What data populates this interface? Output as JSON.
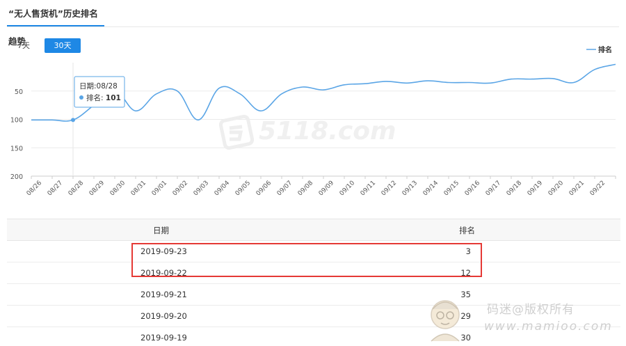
{
  "header": {
    "title": "“无人售货机”历史排名趋势"
  },
  "range_buttons": {
    "seven_days": "7天",
    "thirty_days": "30天"
  },
  "legend": {
    "label": "排名"
  },
  "tooltip": {
    "date_label": "日期:",
    "date_value": "08/28",
    "rank_label": "排名:",
    "rank_value": "101"
  },
  "chart_data": {
    "type": "line",
    "categories": [
      "08/26",
      "08/27",
      "08/28",
      "08/29",
      "08/30",
      "08/31",
      "09/01",
      "09/02",
      "09/03",
      "09/04",
      "09/05",
      "09/06",
      "09/07",
      "09/08",
      "09/09",
      "09/10",
      "09/11",
      "09/12",
      "09/13",
      "09/14",
      "09/15",
      "09/16",
      "09/17",
      "09/18",
      "09/19",
      "09/20",
      "09/21",
      "09/22",
      "09/23"
    ],
    "axis_tick_categories": [
      "08/26",
      "08/27",
      "08/28",
      "08/29",
      "08/30",
      "08/31",
      "09/01",
      "09/02",
      "09/03",
      "09/04",
      "09/05",
      "09/06",
      "09/07",
      "09/08",
      "09/09",
      "09/10",
      "09/11",
      "09/12",
      "09/13",
      "09/14",
      "09/15",
      "09/16",
      "09/17",
      "09/18",
      "09/19",
      "09/20",
      "09/21",
      "09/22"
    ],
    "series": [
      {
        "name": "排名",
        "values": [
          101,
          101,
          101,
          75,
          48,
          85,
          55,
          50,
          101,
          45,
          55,
          85,
          55,
          43,
          48,
          39,
          37,
          33,
          36,
          32,
          35,
          35,
          36,
          29,
          29,
          28,
          35,
          12,
          3
        ]
      }
    ],
    "yticks": [
      50,
      100,
      150,
      200
    ],
    "ylim": [
      0,
      200
    ],
    "y_inverted": true,
    "highlight_index": 2,
    "color": "#5aa5e6",
    "grid": true,
    "legend_position": "top-right"
  },
  "table": {
    "headers": {
      "date": "日期",
      "rank": "排名"
    },
    "rows": [
      {
        "date": "2019-09-23",
        "rank": "3"
      },
      {
        "date": "2019-09-22",
        "rank": "12"
      },
      {
        "date": "2019-09-21",
        "rank": "35"
      },
      {
        "date": "2019-09-20",
        "rank": "29"
      },
      {
        "date": "2019-09-19",
        "rank": "30"
      }
    ]
  },
  "watermark": {
    "line1": "码迷@版权所有",
    "line2": "www.mamioo.com",
    "chart_mark": "5118.com"
  }
}
